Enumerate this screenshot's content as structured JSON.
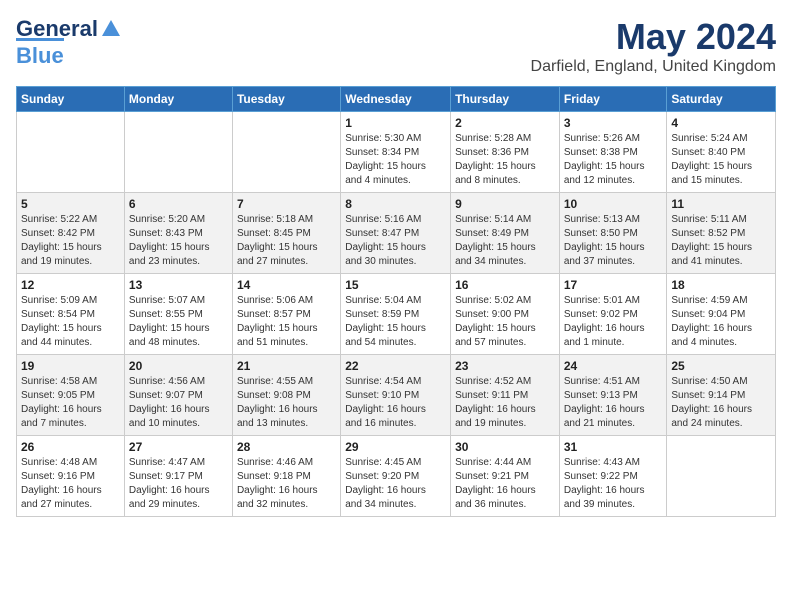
{
  "header": {
    "logo_general": "General",
    "logo_blue": "Blue",
    "month_title": "May 2024",
    "location": "Darfield, England, United Kingdom"
  },
  "days_of_week": [
    "Sunday",
    "Monday",
    "Tuesday",
    "Wednesday",
    "Thursday",
    "Friday",
    "Saturday"
  ],
  "weeks": [
    [
      {
        "day": "",
        "info": ""
      },
      {
        "day": "",
        "info": ""
      },
      {
        "day": "",
        "info": ""
      },
      {
        "day": "1",
        "info": "Sunrise: 5:30 AM\nSunset: 8:34 PM\nDaylight: 15 hours\nand 4 minutes."
      },
      {
        "day": "2",
        "info": "Sunrise: 5:28 AM\nSunset: 8:36 PM\nDaylight: 15 hours\nand 8 minutes."
      },
      {
        "day": "3",
        "info": "Sunrise: 5:26 AM\nSunset: 8:38 PM\nDaylight: 15 hours\nand 12 minutes."
      },
      {
        "day": "4",
        "info": "Sunrise: 5:24 AM\nSunset: 8:40 PM\nDaylight: 15 hours\nand 15 minutes."
      }
    ],
    [
      {
        "day": "5",
        "info": "Sunrise: 5:22 AM\nSunset: 8:42 PM\nDaylight: 15 hours\nand 19 minutes."
      },
      {
        "day": "6",
        "info": "Sunrise: 5:20 AM\nSunset: 8:43 PM\nDaylight: 15 hours\nand 23 minutes."
      },
      {
        "day": "7",
        "info": "Sunrise: 5:18 AM\nSunset: 8:45 PM\nDaylight: 15 hours\nand 27 minutes."
      },
      {
        "day": "8",
        "info": "Sunrise: 5:16 AM\nSunset: 8:47 PM\nDaylight: 15 hours\nand 30 minutes."
      },
      {
        "day": "9",
        "info": "Sunrise: 5:14 AM\nSunset: 8:49 PM\nDaylight: 15 hours\nand 34 minutes."
      },
      {
        "day": "10",
        "info": "Sunrise: 5:13 AM\nSunset: 8:50 PM\nDaylight: 15 hours\nand 37 minutes."
      },
      {
        "day": "11",
        "info": "Sunrise: 5:11 AM\nSunset: 8:52 PM\nDaylight: 15 hours\nand 41 minutes."
      }
    ],
    [
      {
        "day": "12",
        "info": "Sunrise: 5:09 AM\nSunset: 8:54 PM\nDaylight: 15 hours\nand 44 minutes."
      },
      {
        "day": "13",
        "info": "Sunrise: 5:07 AM\nSunset: 8:55 PM\nDaylight: 15 hours\nand 48 minutes."
      },
      {
        "day": "14",
        "info": "Sunrise: 5:06 AM\nSunset: 8:57 PM\nDaylight: 15 hours\nand 51 minutes."
      },
      {
        "day": "15",
        "info": "Sunrise: 5:04 AM\nSunset: 8:59 PM\nDaylight: 15 hours\nand 54 minutes."
      },
      {
        "day": "16",
        "info": "Sunrise: 5:02 AM\nSunset: 9:00 PM\nDaylight: 15 hours\nand 57 minutes."
      },
      {
        "day": "17",
        "info": "Sunrise: 5:01 AM\nSunset: 9:02 PM\nDaylight: 16 hours\nand 1 minute."
      },
      {
        "day": "18",
        "info": "Sunrise: 4:59 AM\nSunset: 9:04 PM\nDaylight: 16 hours\nand 4 minutes."
      }
    ],
    [
      {
        "day": "19",
        "info": "Sunrise: 4:58 AM\nSunset: 9:05 PM\nDaylight: 16 hours\nand 7 minutes."
      },
      {
        "day": "20",
        "info": "Sunrise: 4:56 AM\nSunset: 9:07 PM\nDaylight: 16 hours\nand 10 minutes."
      },
      {
        "day": "21",
        "info": "Sunrise: 4:55 AM\nSunset: 9:08 PM\nDaylight: 16 hours\nand 13 minutes."
      },
      {
        "day": "22",
        "info": "Sunrise: 4:54 AM\nSunset: 9:10 PM\nDaylight: 16 hours\nand 16 minutes."
      },
      {
        "day": "23",
        "info": "Sunrise: 4:52 AM\nSunset: 9:11 PM\nDaylight: 16 hours\nand 19 minutes."
      },
      {
        "day": "24",
        "info": "Sunrise: 4:51 AM\nSunset: 9:13 PM\nDaylight: 16 hours\nand 21 minutes."
      },
      {
        "day": "25",
        "info": "Sunrise: 4:50 AM\nSunset: 9:14 PM\nDaylight: 16 hours\nand 24 minutes."
      }
    ],
    [
      {
        "day": "26",
        "info": "Sunrise: 4:48 AM\nSunset: 9:16 PM\nDaylight: 16 hours\nand 27 minutes."
      },
      {
        "day": "27",
        "info": "Sunrise: 4:47 AM\nSunset: 9:17 PM\nDaylight: 16 hours\nand 29 minutes."
      },
      {
        "day": "28",
        "info": "Sunrise: 4:46 AM\nSunset: 9:18 PM\nDaylight: 16 hours\nand 32 minutes."
      },
      {
        "day": "29",
        "info": "Sunrise: 4:45 AM\nSunset: 9:20 PM\nDaylight: 16 hours\nand 34 minutes."
      },
      {
        "day": "30",
        "info": "Sunrise: 4:44 AM\nSunset: 9:21 PM\nDaylight: 16 hours\nand 36 minutes."
      },
      {
        "day": "31",
        "info": "Sunrise: 4:43 AM\nSunset: 9:22 PM\nDaylight: 16 hours\nand 39 minutes."
      },
      {
        "day": "",
        "info": ""
      }
    ]
  ]
}
